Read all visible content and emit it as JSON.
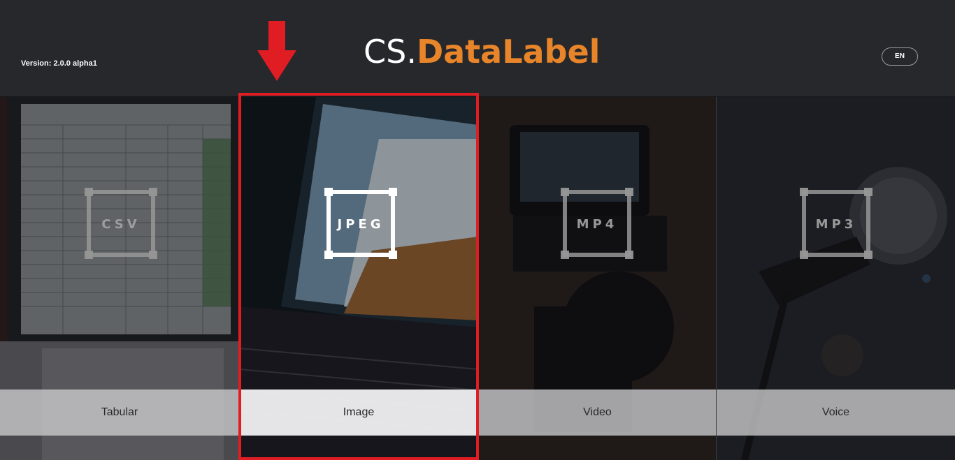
{
  "header": {
    "version": "Version: 2.0.0 alpha1",
    "logo_prefix": "CS.",
    "logo_main": "DataLabel",
    "language_button": "EN"
  },
  "colors": {
    "accent": "#e8852a",
    "highlight": "#e11d24",
    "header_bg": "#26282c"
  },
  "cards": [
    {
      "format": "CSV",
      "label": "Tabular"
    },
    {
      "format": "JPEG",
      "label": "Image"
    },
    {
      "format": "MP4",
      "label": "Video"
    },
    {
      "format": "MP3",
      "label": "Voice"
    }
  ]
}
